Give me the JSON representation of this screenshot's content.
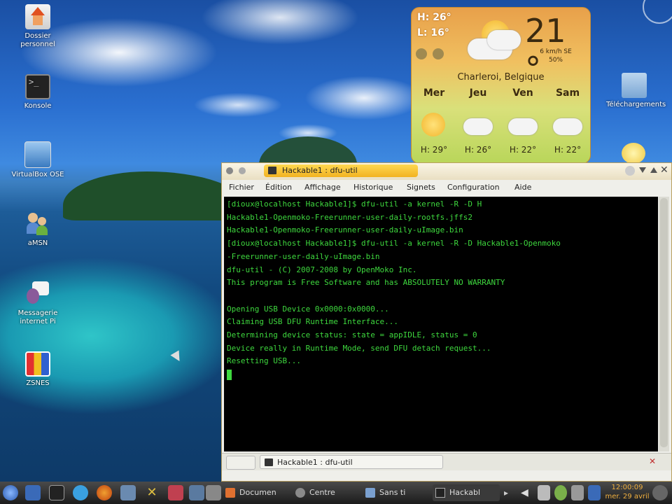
{
  "desktop_icons": [
    {
      "label": "Dossier personnel",
      "icon": "home-folder-icon"
    },
    {
      "label": "Konsole",
      "icon": "terminal-icon"
    },
    {
      "label": "VirtualBox OSE",
      "icon": "virtualbox-icon"
    },
    {
      "label": "aMSN",
      "icon": "amsn-icon"
    },
    {
      "label": "Messagerie internet Pi",
      "icon": "messenger-icon"
    },
    {
      "label": "ZSNES",
      "icon": "zsnes-icon"
    },
    {
      "label": "Téléchargements",
      "icon": "download-folder-icon"
    }
  ],
  "weather": {
    "high": "H: 26°",
    "low": "L: 16°",
    "temperature": "21 °",
    "wind": "6 km/h SE",
    "humidity": "50%",
    "city": "Charleroi, Belgique",
    "days": [
      {
        "name": "Mer",
        "high": "H: 29°",
        "icon": "sun-icon"
      },
      {
        "name": "Jeu",
        "high": "H: 26°",
        "icon": "cloud-icon"
      },
      {
        "name": "Ven",
        "high": "H: 22°",
        "icon": "cloud-icon"
      },
      {
        "name": "Sam",
        "high": "H: 22°",
        "icon": "cloud-icon"
      }
    ]
  },
  "window": {
    "title": "Hackable1 : dfu-util",
    "menu": [
      "Fichier",
      "Édition",
      "Affichage",
      "Historique",
      "Signets",
      "Configuration",
      "Aide"
    ],
    "terminal_lines": [
      "[dioux@localhost Hackable1]$ dfu-util -a kernel -R -D H",
      "Hackable1-Openmoko-Freerunner-user-daily-rootfs.jffs2",
      "Hackable1-Openmoko-Freerunner-user-daily-uImage.bin",
      "[dioux@localhost Hackable1]$ dfu-util -a kernel -R -D Hackable1-Openmoko",
      "-Freerunner-user-daily-uImage.bin",
      "dfu-util - (C) 2007-2008 by OpenMoko Inc.",
      "This program is Free Software and has ABSOLUTELY NO WARRANTY",
      "",
      "Opening USB Device 0x0000:0x0000...",
      "Claiming USB DFU Runtime Interface...",
      "Determining device status: state = appIDLE, status = 0",
      "Device really in Runtime Mode, send DFU detach request...",
      "Resetting USB..."
    ],
    "tab_label": "Hackable1 : dfu-util"
  },
  "taskbar": {
    "tasks": [
      "Documen",
      "Centre",
      "Sans ti",
      "Hackabl"
    ],
    "clock_time": "12:00:09",
    "clock_date": "mer. 29 avril"
  }
}
